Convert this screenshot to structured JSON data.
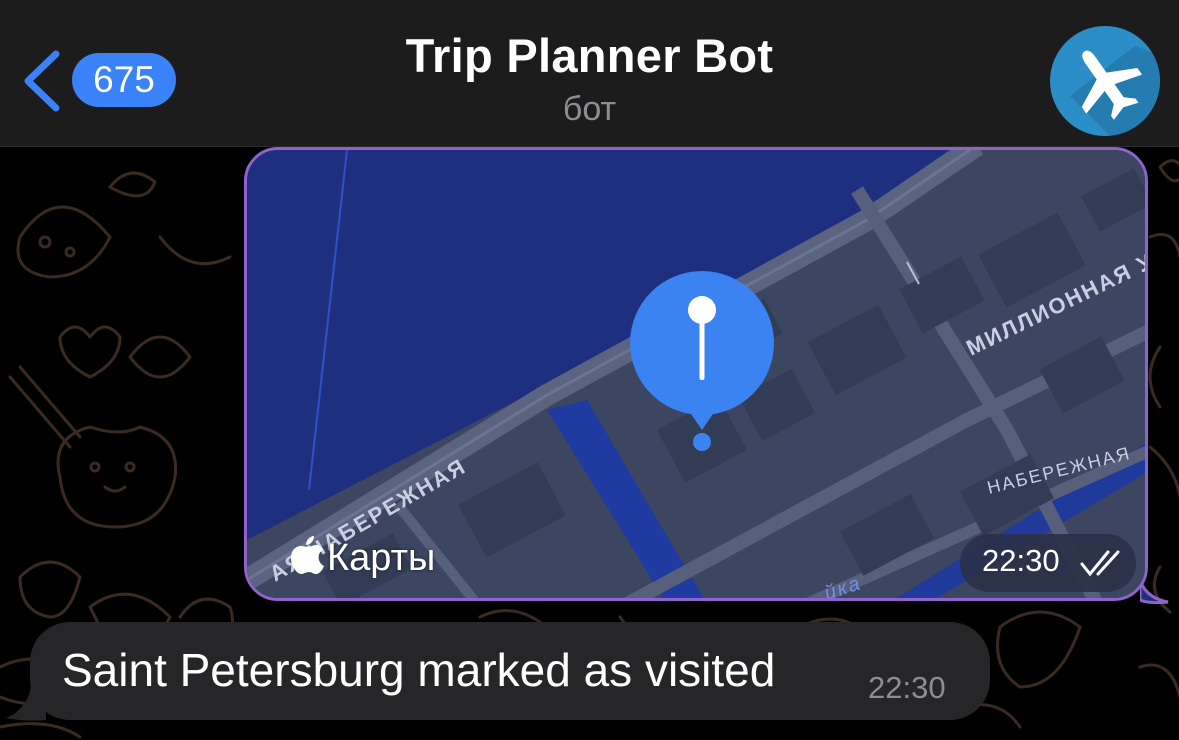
{
  "header": {
    "back_icon": "chevron-left-icon",
    "unread_count": "675",
    "title": "Trip Planner Bot",
    "subtitle": "бот",
    "avatar_icon": "airplane-icon",
    "accent": "#3a82f7",
    "avatar_color": "#2c8ec7"
  },
  "messages": [
    {
      "type": "location",
      "outgoing": true,
      "map": {
        "provider_label": "Карты",
        "provider_icon": "apple-logo-icon",
        "street_labels": [
          "АЯ НАБЕРЕЖНАЯ",
          "МИЛЛИОННАЯ У",
          "НАБЕРЕЖНАЯ",
          "йка"
        ],
        "pin_icon": "location-pin-icon"
      },
      "time": "22:30",
      "status_icon": "double-check-icon",
      "border_color": "#8f63c9"
    },
    {
      "type": "text",
      "outgoing": false,
      "text": "Saint Petersburg marked as visited",
      "time": "22:30"
    }
  ]
}
